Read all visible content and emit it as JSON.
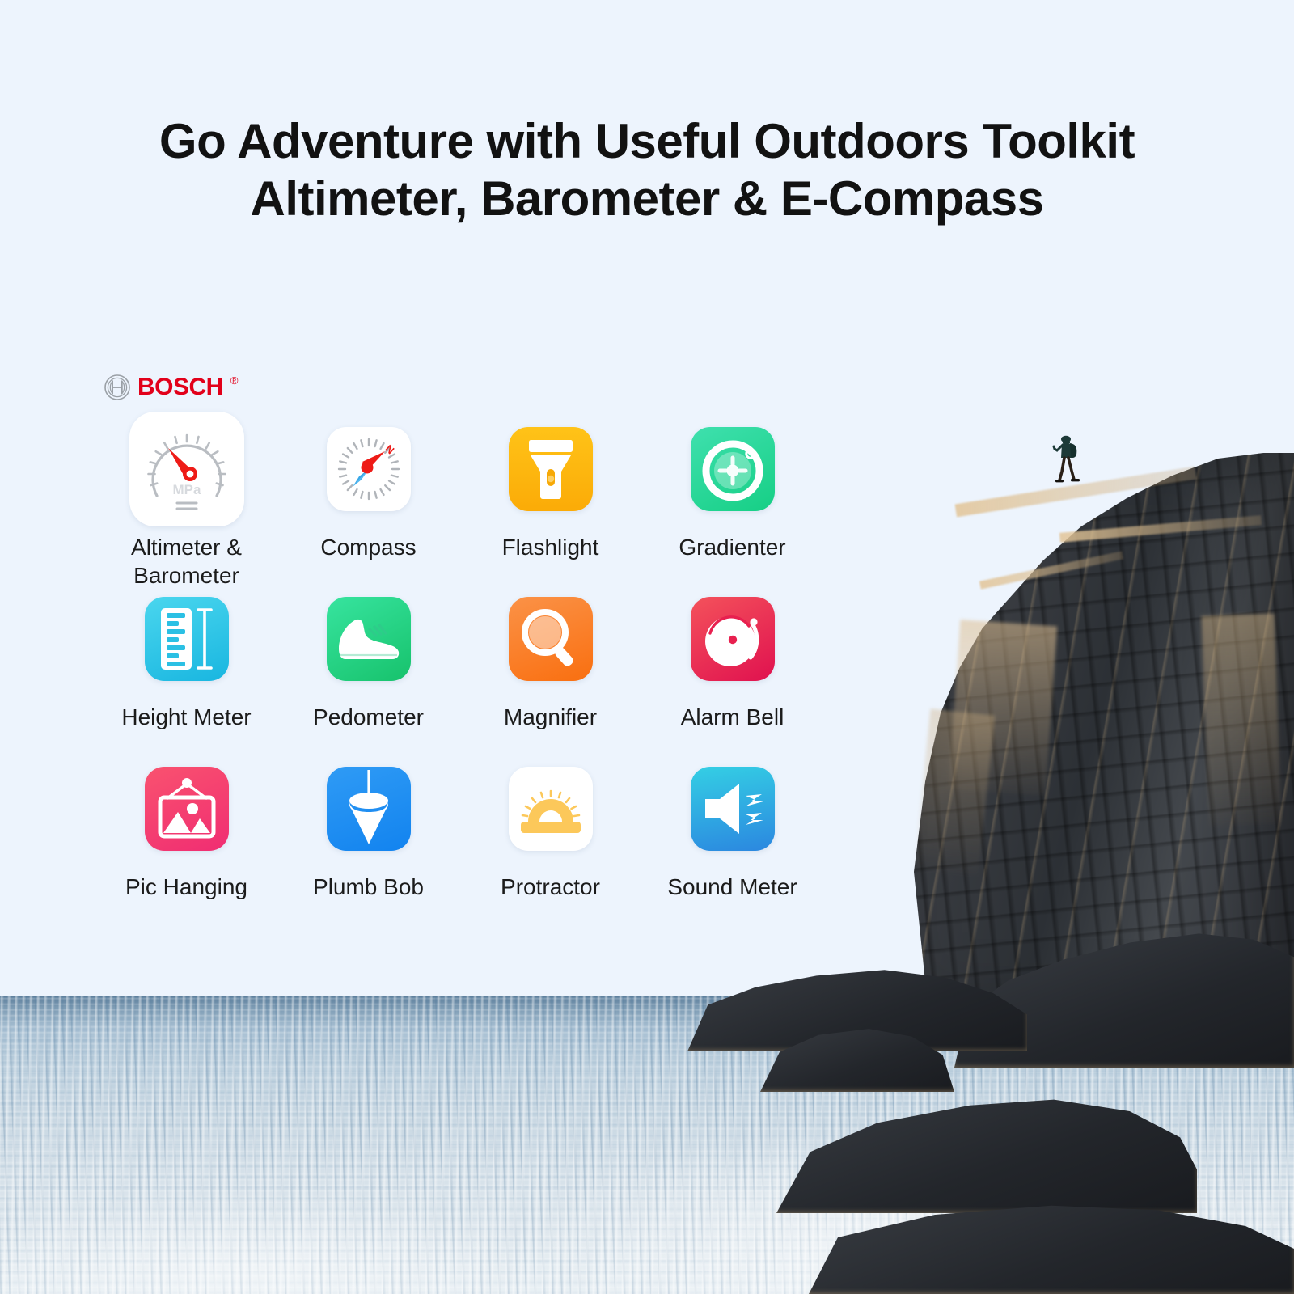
{
  "page": {
    "background_color": "#edf4fd",
    "title_color": "#121212"
  },
  "title": {
    "line1": "Go Adventure with Useful Outdoors Toolkit",
    "line2": "Altimeter, Barometer & E-Compass"
  },
  "brand": {
    "name": "BOSCH",
    "registered_mark": "®",
    "color": "#e2001a",
    "symbol_icon": "bosch-armature-icon"
  },
  "grid": {
    "rows": [
      {
        "items": [
          {
            "label": "Altimeter &\nBarometer",
            "icon": "gauge-icon",
            "tile_style": "bg-white",
            "size": "big"
          },
          {
            "label": "Compass",
            "icon": "compass-icon",
            "tile_style": "bg-white",
            "size": "normal"
          },
          {
            "label": "Flashlight",
            "icon": "flashlight-icon",
            "tile_style": "bg-amber",
            "size": "normal"
          },
          {
            "label": "Gradienter",
            "icon": "bubble-level-icon",
            "tile_style": "bg-green",
            "size": "normal"
          }
        ]
      },
      {
        "items": [
          {
            "label": "Height Meter",
            "icon": "ruler-icon",
            "tile_style": "bg-cyan",
            "size": "normal"
          },
          {
            "label": "Pedometer",
            "icon": "sneaker-icon",
            "tile_style": "bg-mint",
            "size": "normal"
          },
          {
            "label": "Magnifier",
            "icon": "magnifying-glass-icon",
            "tile_style": "bg-orange",
            "size": "normal"
          },
          {
            "label": "Alarm Bell",
            "icon": "alarm-bell-icon",
            "tile_style": "bg-red",
            "size": "normal"
          }
        ]
      },
      {
        "items": [
          {
            "label": "Pic Hanging",
            "icon": "picture-frame-icon",
            "tile_style": "bg-pink",
            "size": "normal"
          },
          {
            "label": "Plumb Bob",
            "icon": "plumb-bob-icon",
            "tile_style": "bg-blue",
            "size": "normal"
          },
          {
            "label": "Protractor",
            "icon": "protractor-icon",
            "tile_style": "bg-white",
            "size": "normal"
          },
          {
            "label": "Sound Meter",
            "icon": "speaker-waves-icon",
            "tile_style": "bg-skyblue",
            "size": "normal"
          }
        ]
      }
    ]
  },
  "gauge_icon": {
    "unit_label": "MPa"
  },
  "compass_icon": {
    "north_label": "N"
  },
  "photo": {
    "description": "hiker-on-cliff-by-sea",
    "subject": "hiker-silhouette",
    "terrain": "rocky-cliff",
    "water": "sea"
  }
}
